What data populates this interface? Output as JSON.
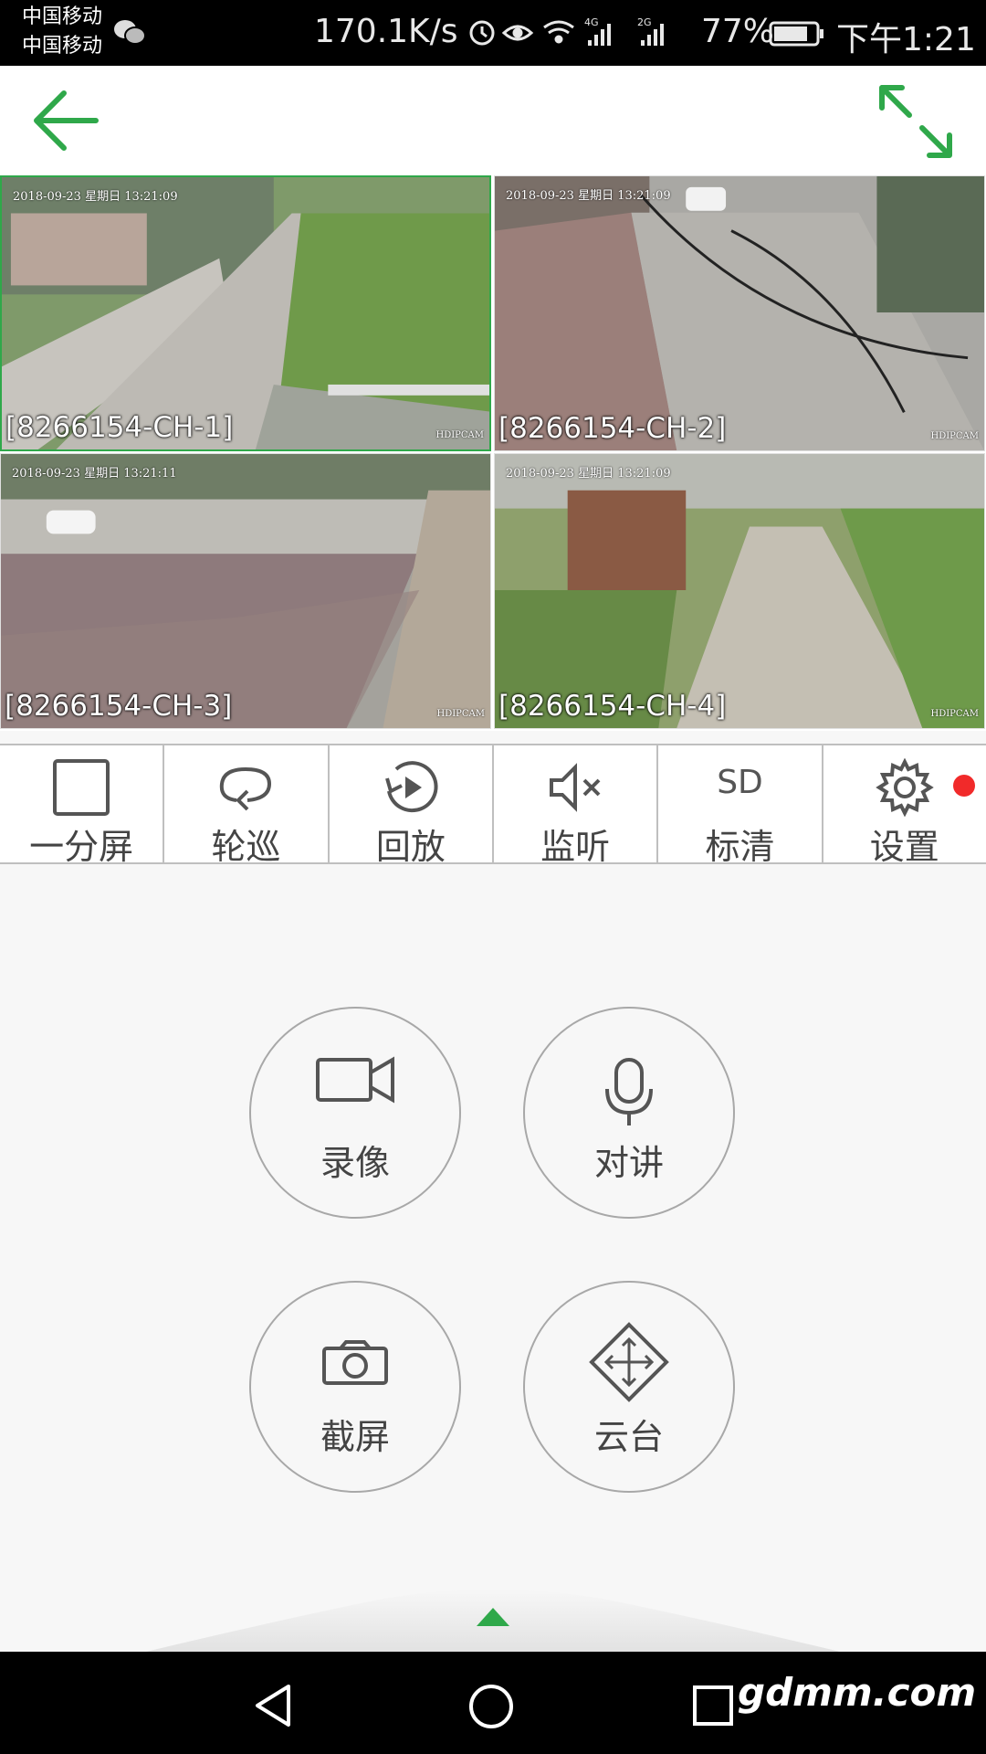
{
  "status_bar": {
    "carrier_1": "中国移动",
    "carrier_2": "中国移动",
    "net_speed": "170.1K/s",
    "signal_1": "4G",
    "signal_2": "2G",
    "battery": "77%",
    "time": "下午1:21"
  },
  "cameras": [
    {
      "label": "[8266154-CH-1]",
      "timestamp": "2018-09-23  星期日  13:21:09",
      "brand": "HDIPCAM",
      "selected": true
    },
    {
      "label": "[8266154-CH-2]",
      "timestamp": "2018-09-23  星期日  13:21:09",
      "brand": "HDIPCAM",
      "selected": false
    },
    {
      "label": "[8266154-CH-3]",
      "timestamp": "2018-09-23  星期日  13:21:11",
      "brand": "HDIPCAM",
      "selected": false
    },
    {
      "label": "[8266154-CH-4]",
      "timestamp": "2018-09-23  星期日  13:21:09",
      "brand": "HDIPCAM",
      "selected": false
    }
  ],
  "toolbar": {
    "split_label": "一分屏",
    "cruise_label": "轮巡",
    "playback_label": "回放",
    "listen_label": "监听",
    "quality_icon_text": "SD",
    "quality_label": "标清",
    "settings_label": "设置"
  },
  "actions": {
    "record_label": "录像",
    "talk_label": "对讲",
    "snapshot_label": "截屏",
    "ptz_label": "云台"
  },
  "watermark": "gdmm.com",
  "colors": {
    "accent": "#2fa84a",
    "badge": "#f12a2a"
  }
}
